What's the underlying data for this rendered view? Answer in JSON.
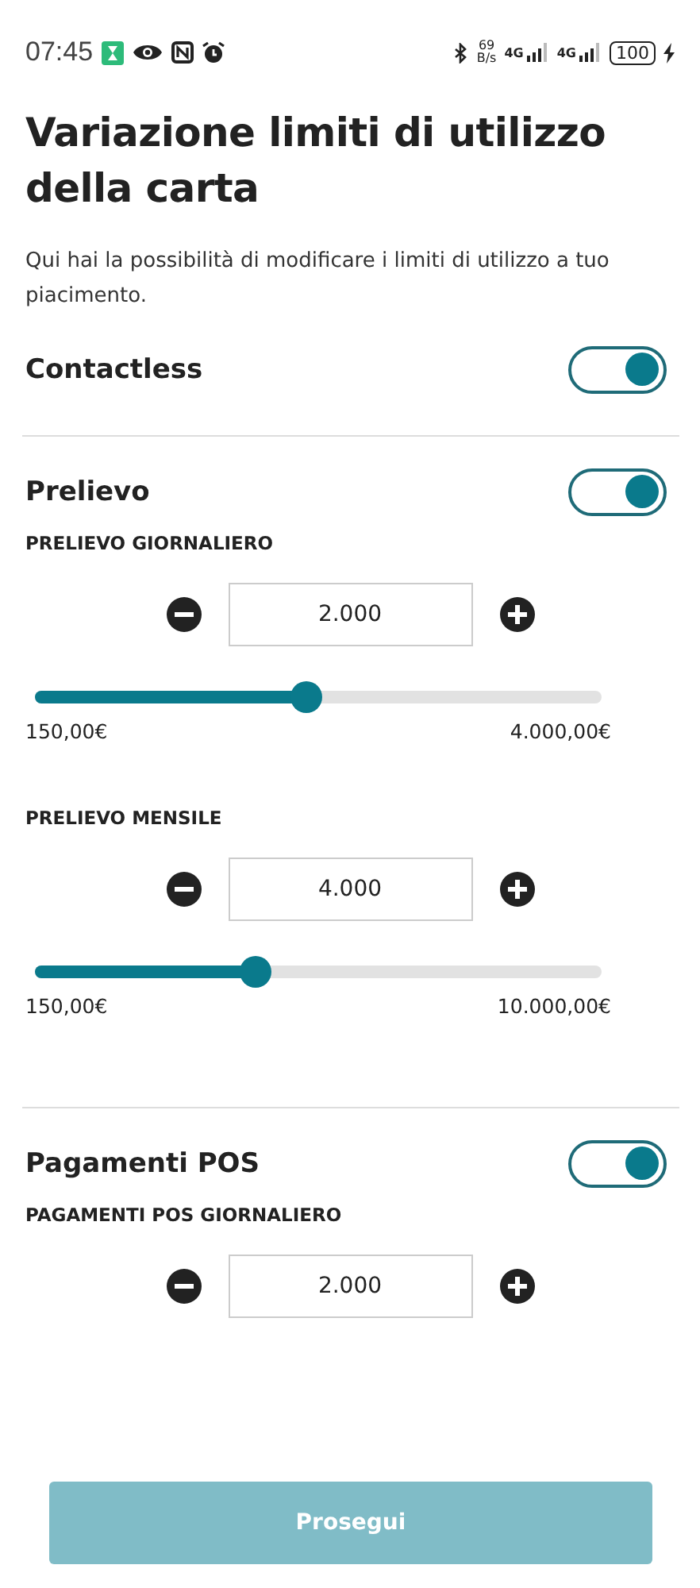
{
  "status_bar": {
    "time": "07:45",
    "speed": [
      "69",
      "B/s"
    ],
    "network": [
      "4G",
      "4G"
    ],
    "battery": "100"
  },
  "title": "Variazione limiti di utilizzo della carta",
  "description": "Qui hai la possibilità di modificare i limiti di utilizzo a tuo piacimento.",
  "sections": [
    {
      "name": "Contactless",
      "on": true
    },
    {
      "name": "Prelievo",
      "on": true,
      "limits": [
        {
          "label": "PRELIEVO GIORNALIERO",
          "value": "2.000",
          "slider": {
            "level": 0.48,
            "min": "150,00€",
            "max": "4.000,00€"
          }
        },
        {
          "label": "PRELIEVO MENSILE",
          "value": "4.000",
          "slider": {
            "level": 0.39,
            "min": "150,00€",
            "max": "10.000,00€"
          }
        }
      ]
    },
    {
      "name": "Pagamenti POS",
      "on": true,
      "limits": [
        {
          "label": "PAGAMENTI POS GIORNALIERO",
          "value": "2.000"
        }
      ]
    }
  ],
  "button": {
    "label": "Prosegui",
    "disabled": true
  }
}
